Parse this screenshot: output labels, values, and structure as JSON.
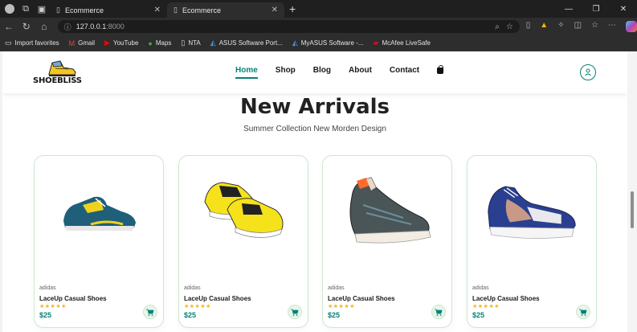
{
  "browser": {
    "tabs": [
      {
        "title": "Ecommerce",
        "close": "✕"
      },
      {
        "title": "Ecommerce",
        "close": "✕"
      }
    ],
    "new_tab": "+",
    "url_host": "127.0.0.1",
    "url_port": ":8000",
    "bookmarks": [
      {
        "label": "Import favorites",
        "icon": "folder-icon"
      },
      {
        "label": "Gmail",
        "icon": "gmail-icon"
      },
      {
        "label": "YouTube",
        "icon": "youtube-icon"
      },
      {
        "label": "Maps",
        "icon": "maps-icon"
      },
      {
        "label": "NTA",
        "icon": "page-icon"
      },
      {
        "label": "ASUS Software Port...",
        "icon": "asus-icon"
      },
      {
        "label": "MyASUS Software -...",
        "icon": "myasus-icon"
      },
      {
        "label": "McAfee LiveSafe",
        "icon": "mcafee-icon"
      }
    ]
  },
  "site": {
    "logo_text": "SHOEBLISS",
    "nav": [
      "Home",
      "Shop",
      "Blog",
      "About",
      "Contact"
    ],
    "active_nav": "Home",
    "accent": "#088178"
  },
  "section": {
    "title": "New Arrivals",
    "subtitle": "Summer Collection New Morden Design"
  },
  "products": [
    {
      "brand": "adidas",
      "name": "LaceUp Casual Shoes",
      "stars": "★★★★★",
      "price": "$25"
    },
    {
      "brand": "adidas",
      "name": "LaceUp Casual Shoes",
      "stars": "★★★★★",
      "price": "$25"
    },
    {
      "brand": "adidas",
      "name": "LaceUp Casual Shoes",
      "stars": "★★★★★",
      "price": "$25"
    },
    {
      "brand": "adidas",
      "name": "LaceUp Casual Shoes",
      "stars": "★★★★★",
      "price": "$25"
    }
  ]
}
